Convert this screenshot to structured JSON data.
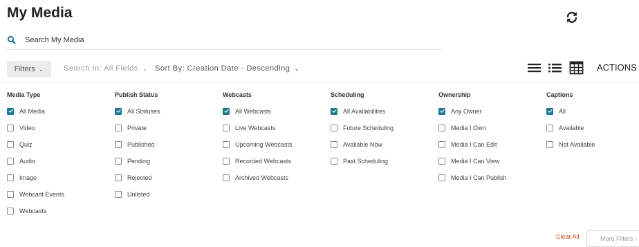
{
  "page": {
    "title": "My Media"
  },
  "search": {
    "placeholder": "Search My Media"
  },
  "toolbar": {
    "filters_label": "Filters",
    "search_in_label": "Search In: All Fields",
    "sort_label": "Sort By: Creation Date - Descending",
    "actions_label": "ACTIONS",
    "view_icons": [
      "list-view-icon",
      "detailed-list-view-icon",
      "grid-view-icon"
    ]
  },
  "colors": {
    "accent": "#1f7891",
    "clear_all": "#d04a1a",
    "filters_bg": "#ececec"
  },
  "filters": {
    "columns": [
      {
        "heading": "Media Type",
        "options": [
          {
            "label": "All Media",
            "checked": true
          },
          {
            "label": "Video",
            "checked": false
          },
          {
            "label": "Quiz",
            "checked": false
          },
          {
            "label": "Audio",
            "checked": false
          },
          {
            "label": "Image",
            "checked": false
          },
          {
            "label": "Webcast Events",
            "checked": false
          },
          {
            "label": "Webcasts",
            "checked": false
          }
        ]
      },
      {
        "heading": "Publish Status",
        "options": [
          {
            "label": "All Statuses",
            "checked": true
          },
          {
            "label": "Private",
            "checked": false
          },
          {
            "label": "Published",
            "checked": false
          },
          {
            "label": "Pending",
            "checked": false
          },
          {
            "label": "Rejected",
            "checked": false
          },
          {
            "label": "Unlisted",
            "checked": false
          }
        ]
      },
      {
        "heading": "Webcasts",
        "options": [
          {
            "label": "All Webcasts",
            "checked": true
          },
          {
            "label": "Live Webcasts",
            "checked": false
          },
          {
            "label": "Upcoming Webcasts",
            "checked": false
          },
          {
            "label": "Recorded Webcasts",
            "checked": false
          },
          {
            "label": "Archived Webcasts",
            "checked": false
          }
        ]
      },
      {
        "heading": "Scheduling",
        "options": [
          {
            "label": "All Availabilities",
            "checked": true
          },
          {
            "label": "Future Scheduling",
            "checked": false
          },
          {
            "label": "Available Now",
            "checked": false
          },
          {
            "label": "Past Scheduling",
            "checked": false
          }
        ]
      },
      {
        "heading": "Ownership",
        "options": [
          {
            "label": "Any Owner",
            "checked": true
          },
          {
            "label": "Media I Own",
            "checked": false
          },
          {
            "label": "Media I Can Edit",
            "checked": false
          },
          {
            "label": "Media I Can View",
            "checked": false
          },
          {
            "label": "Media I Can Publish",
            "checked": false
          }
        ]
      },
      {
        "heading": "Captions",
        "options": [
          {
            "label": "All",
            "checked": true
          },
          {
            "label": "Available",
            "checked": false
          },
          {
            "label": "Not Available",
            "checked": false
          }
        ]
      }
    ],
    "clear_all_label": "Clear All",
    "more_filters_label": "More Filters"
  }
}
